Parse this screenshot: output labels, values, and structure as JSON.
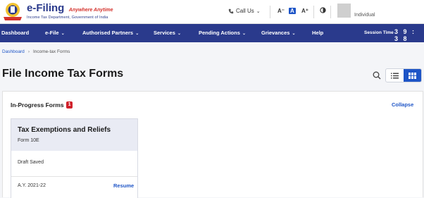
{
  "header": {
    "brand_title": "e-Filing",
    "brand_tagline": "Anywhere Anytime",
    "brand_dept": "Income Tax Department, Government of India",
    "call_us": "Call Us",
    "font_decrease": "A⁻",
    "font_normal": "A",
    "font_increase": "A⁺",
    "user_role": "Individual"
  },
  "nav": {
    "items": [
      {
        "label": "Dashboard",
        "chevron": ""
      },
      {
        "label": "e-File",
        "chevron": "⌄"
      },
      {
        "label": "Authorised Partners",
        "chevron": "⌄"
      },
      {
        "label": "Services",
        "chevron": "⌄"
      },
      {
        "label": "Pending Actions",
        "chevron": "⌄"
      },
      {
        "label": "Grievances",
        "chevron": "⌄"
      },
      {
        "label": "Help",
        "chevron": ""
      }
    ],
    "session_label": "Session Time",
    "session_time": "3 9 : 3 8"
  },
  "breadcrumb": {
    "home": "Dashboard",
    "separator": "›",
    "current": "Income-tax Forms"
  },
  "page": {
    "title": "File Income Tax Forms"
  },
  "in_progress": {
    "label": "In-Progress Forms",
    "count": "1",
    "collapse_label": "Collapse",
    "cards": [
      {
        "title": "Tax Exemptions and Reliefs",
        "form": "Form 10E",
        "status": "Draft Saved",
        "ay": "A.Y. 2021-22",
        "action": "Resume"
      }
    ]
  },
  "colors": {
    "nav_bg": "#2a3a8c",
    "accent": "#1e55c7",
    "badge": "#d0202a",
    "card_head": "#e9ebf4"
  }
}
